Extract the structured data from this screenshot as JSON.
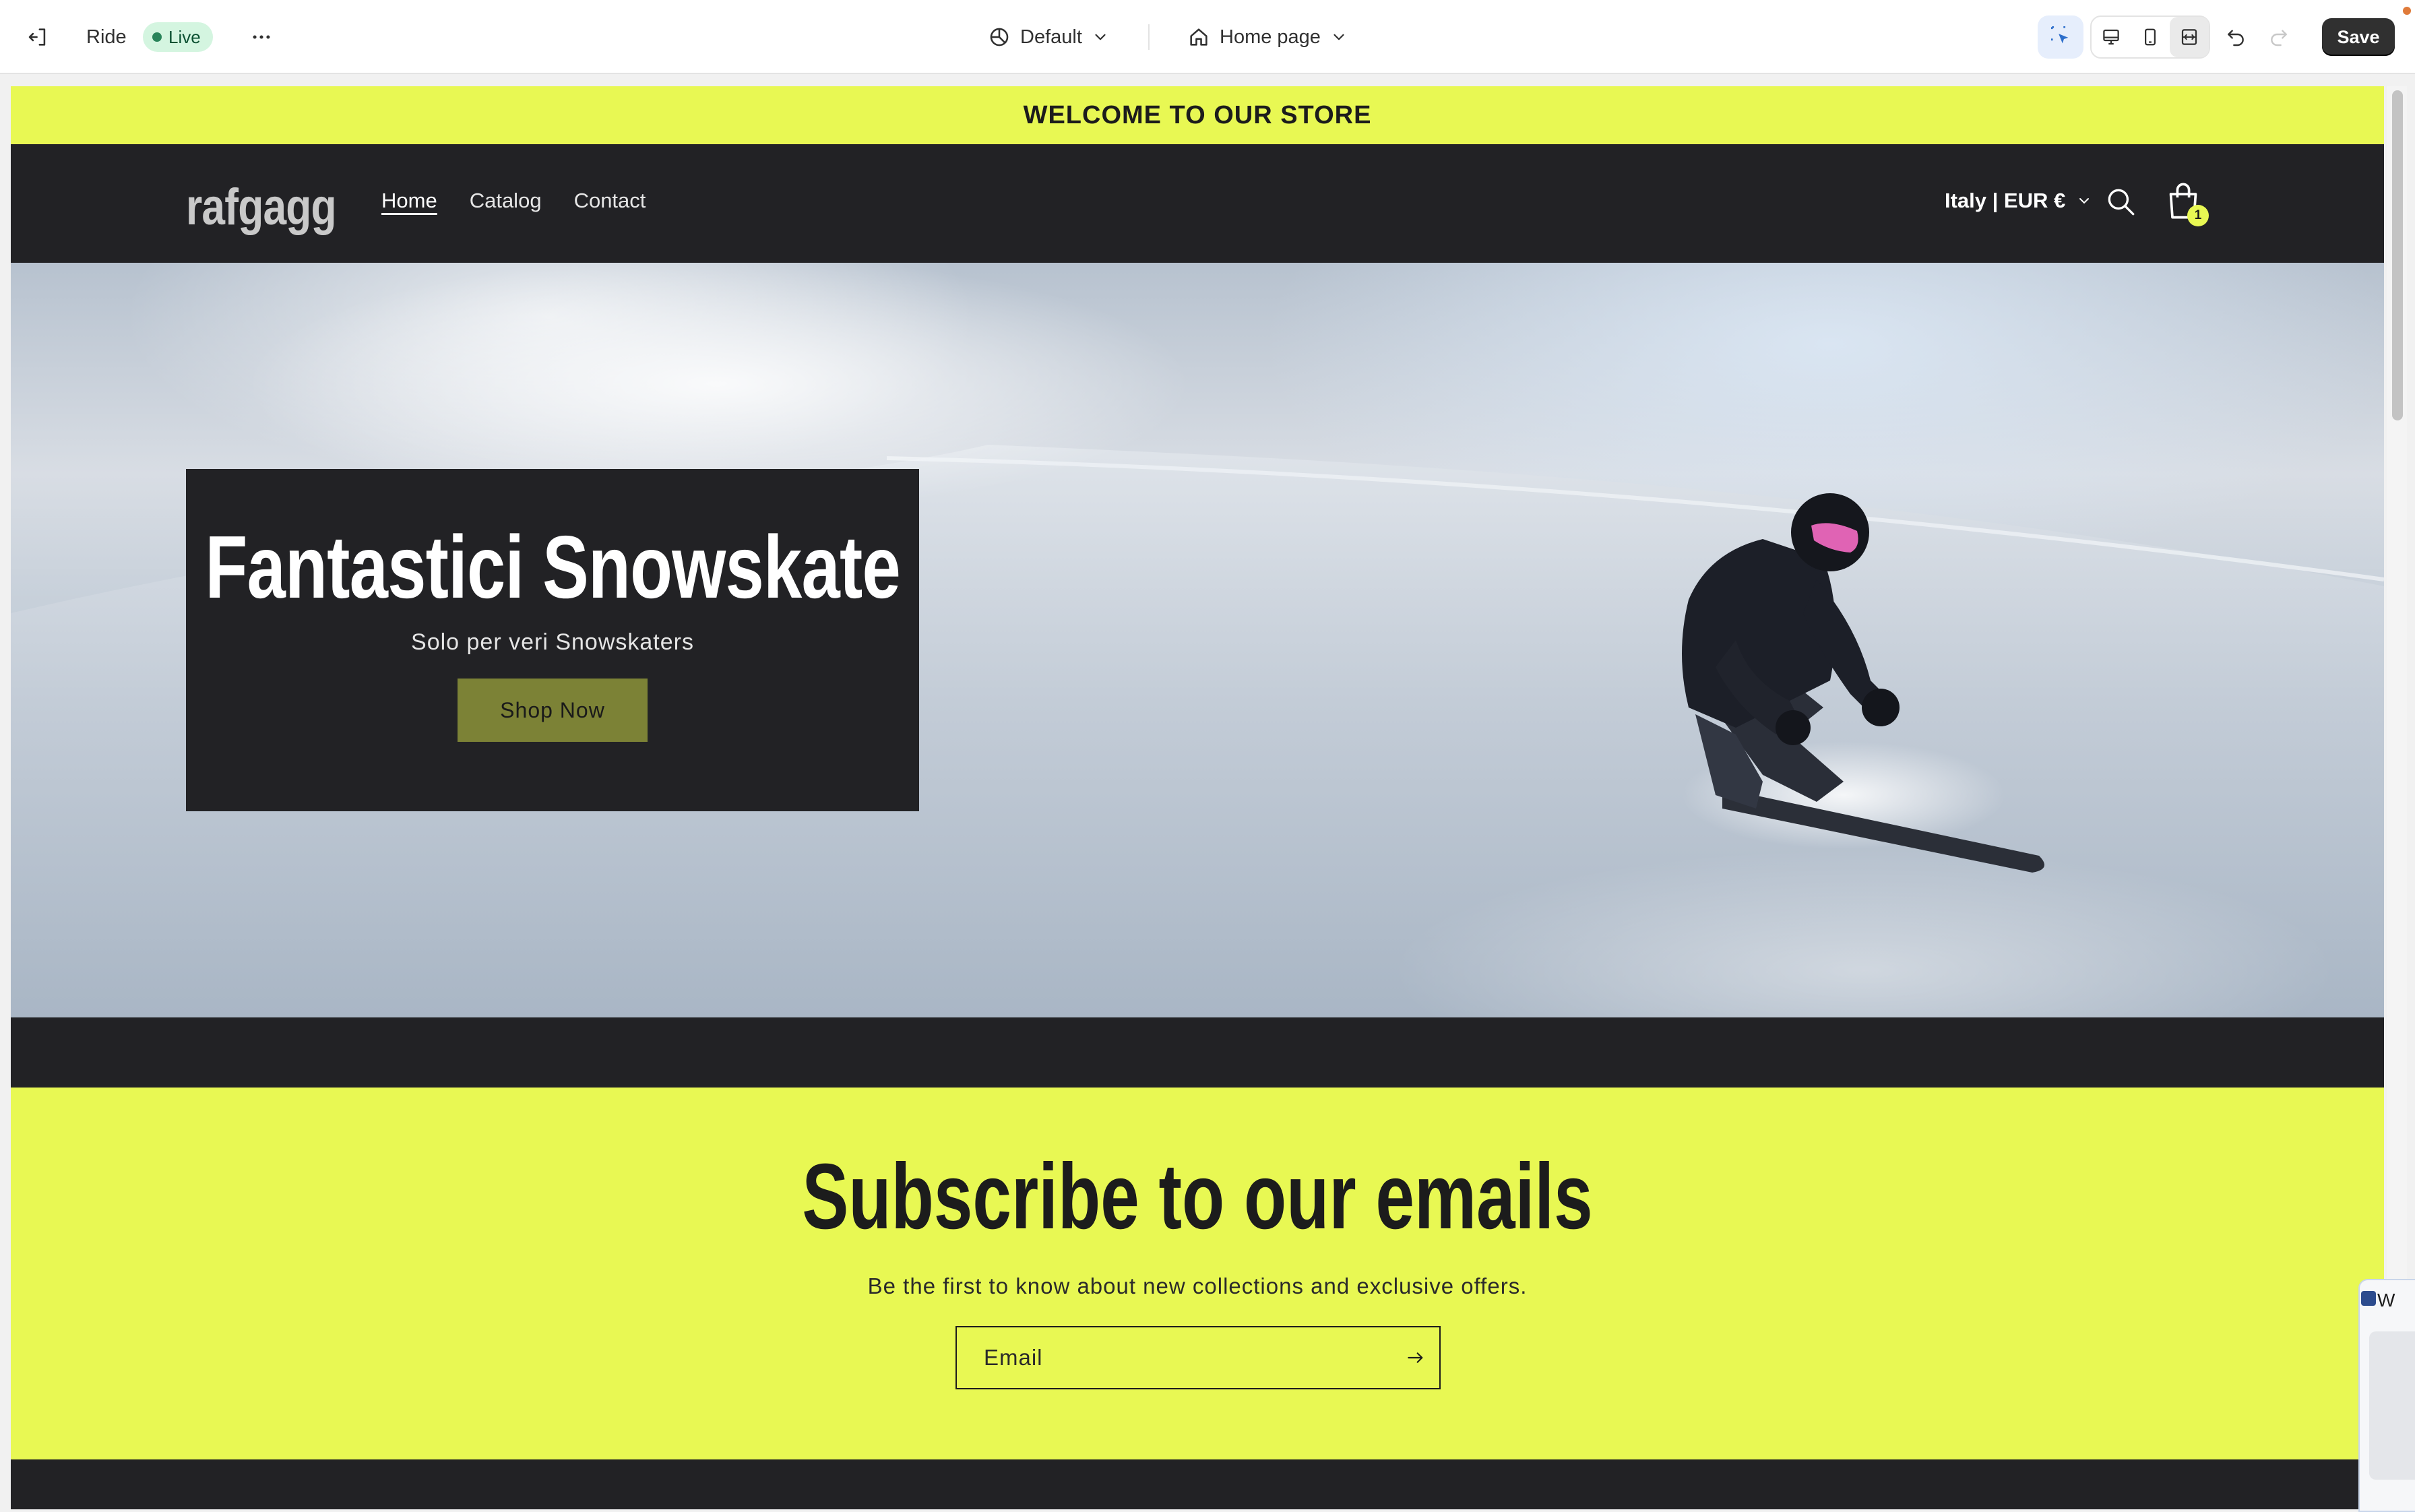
{
  "editor": {
    "theme_name": "Ride",
    "status_badge": "Live",
    "theme_preset": "Default",
    "page_selector": "Home page",
    "save_label": "Save",
    "accent_color": "#303030"
  },
  "store": {
    "announcement": "WELCOME TO OUR STORE",
    "logo_text": "rafgagg",
    "nav": [
      {
        "label": "Home",
        "active": true
      },
      {
        "label": "Catalog",
        "active": false
      },
      {
        "label": "Contact",
        "active": false
      }
    ],
    "country_selector": "Italy | EUR €",
    "cart_count": "1",
    "brand_color": "#e8f853",
    "dark_color": "#222225"
  },
  "hero": {
    "title": "Fantastici Snowskate",
    "subtitle": "Solo per veri Snowskaters",
    "cta_label": "Shop Now",
    "cta_color": "#7c8236"
  },
  "newsletter": {
    "title": "Subscribe to our emails",
    "subtitle": "Be the first to know about new collections and exclusive offers.",
    "email_placeholder": "Email"
  },
  "floating_window": {
    "title_fragment": "W"
  }
}
